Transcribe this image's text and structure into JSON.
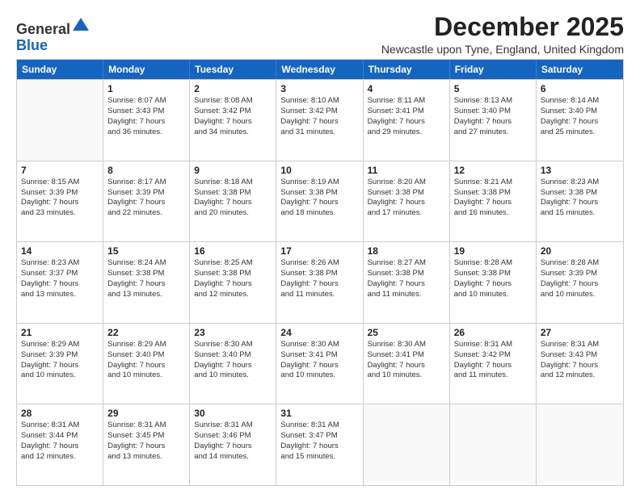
{
  "logo": {
    "general": "General",
    "blue": "Blue"
  },
  "header": {
    "title": "December 2025",
    "location": "Newcastle upon Tyne, England, United Kingdom"
  },
  "days": [
    "Sunday",
    "Monday",
    "Tuesday",
    "Wednesday",
    "Thursday",
    "Friday",
    "Saturday"
  ],
  "weeks": [
    [
      {
        "num": "",
        "lines": []
      },
      {
        "num": "1",
        "lines": [
          "Sunrise: 8:07 AM",
          "Sunset: 3:43 PM",
          "Daylight: 7 hours",
          "and 36 minutes."
        ]
      },
      {
        "num": "2",
        "lines": [
          "Sunrise: 8:08 AM",
          "Sunset: 3:42 PM",
          "Daylight: 7 hours",
          "and 34 minutes."
        ]
      },
      {
        "num": "3",
        "lines": [
          "Sunrise: 8:10 AM",
          "Sunset: 3:42 PM",
          "Daylight: 7 hours",
          "and 31 minutes."
        ]
      },
      {
        "num": "4",
        "lines": [
          "Sunrise: 8:11 AM",
          "Sunset: 3:41 PM",
          "Daylight: 7 hours",
          "and 29 minutes."
        ]
      },
      {
        "num": "5",
        "lines": [
          "Sunrise: 8:13 AM",
          "Sunset: 3:40 PM",
          "Daylight: 7 hours",
          "and 27 minutes."
        ]
      },
      {
        "num": "6",
        "lines": [
          "Sunrise: 8:14 AM",
          "Sunset: 3:40 PM",
          "Daylight: 7 hours",
          "and 25 minutes."
        ]
      }
    ],
    [
      {
        "num": "7",
        "lines": [
          "Sunrise: 8:15 AM",
          "Sunset: 3:39 PM",
          "Daylight: 7 hours",
          "and 23 minutes."
        ]
      },
      {
        "num": "8",
        "lines": [
          "Sunrise: 8:17 AM",
          "Sunset: 3:39 PM",
          "Daylight: 7 hours",
          "and 22 minutes."
        ]
      },
      {
        "num": "9",
        "lines": [
          "Sunrise: 8:18 AM",
          "Sunset: 3:38 PM",
          "Daylight: 7 hours",
          "and 20 minutes."
        ]
      },
      {
        "num": "10",
        "lines": [
          "Sunrise: 8:19 AM",
          "Sunset: 3:38 PM",
          "Daylight: 7 hours",
          "and 18 minutes."
        ]
      },
      {
        "num": "11",
        "lines": [
          "Sunrise: 8:20 AM",
          "Sunset: 3:38 PM",
          "Daylight: 7 hours",
          "and 17 minutes."
        ]
      },
      {
        "num": "12",
        "lines": [
          "Sunrise: 8:21 AM",
          "Sunset: 3:38 PM",
          "Daylight: 7 hours",
          "and 16 minutes."
        ]
      },
      {
        "num": "13",
        "lines": [
          "Sunrise: 8:23 AM",
          "Sunset: 3:38 PM",
          "Daylight: 7 hours",
          "and 15 minutes."
        ]
      }
    ],
    [
      {
        "num": "14",
        "lines": [
          "Sunrise: 8:23 AM",
          "Sunset: 3:37 PM",
          "Daylight: 7 hours",
          "and 13 minutes."
        ]
      },
      {
        "num": "15",
        "lines": [
          "Sunrise: 8:24 AM",
          "Sunset: 3:38 PM",
          "Daylight: 7 hours",
          "and 13 minutes."
        ]
      },
      {
        "num": "16",
        "lines": [
          "Sunrise: 8:25 AM",
          "Sunset: 3:38 PM",
          "Daylight: 7 hours",
          "and 12 minutes."
        ]
      },
      {
        "num": "17",
        "lines": [
          "Sunrise: 8:26 AM",
          "Sunset: 3:38 PM",
          "Daylight: 7 hours",
          "and 11 minutes."
        ]
      },
      {
        "num": "18",
        "lines": [
          "Sunrise: 8:27 AM",
          "Sunset: 3:38 PM",
          "Daylight: 7 hours",
          "and 11 minutes."
        ]
      },
      {
        "num": "19",
        "lines": [
          "Sunrise: 8:28 AM",
          "Sunset: 3:38 PM",
          "Daylight: 7 hours",
          "and 10 minutes."
        ]
      },
      {
        "num": "20",
        "lines": [
          "Sunrise: 8:28 AM",
          "Sunset: 3:39 PM",
          "Daylight: 7 hours",
          "and 10 minutes."
        ]
      }
    ],
    [
      {
        "num": "21",
        "lines": [
          "Sunrise: 8:29 AM",
          "Sunset: 3:39 PM",
          "Daylight: 7 hours",
          "and 10 minutes."
        ]
      },
      {
        "num": "22",
        "lines": [
          "Sunrise: 8:29 AM",
          "Sunset: 3:40 PM",
          "Daylight: 7 hours",
          "and 10 minutes."
        ]
      },
      {
        "num": "23",
        "lines": [
          "Sunrise: 8:30 AM",
          "Sunset: 3:40 PM",
          "Daylight: 7 hours",
          "and 10 minutes."
        ]
      },
      {
        "num": "24",
        "lines": [
          "Sunrise: 8:30 AM",
          "Sunset: 3:41 PM",
          "Daylight: 7 hours",
          "and 10 minutes."
        ]
      },
      {
        "num": "25",
        "lines": [
          "Sunrise: 8:30 AM",
          "Sunset: 3:41 PM",
          "Daylight: 7 hours",
          "and 10 minutes."
        ]
      },
      {
        "num": "26",
        "lines": [
          "Sunrise: 8:31 AM",
          "Sunset: 3:42 PM",
          "Daylight: 7 hours",
          "and 11 minutes."
        ]
      },
      {
        "num": "27",
        "lines": [
          "Sunrise: 8:31 AM",
          "Sunset: 3:43 PM",
          "Daylight: 7 hours",
          "and 12 minutes."
        ]
      }
    ],
    [
      {
        "num": "28",
        "lines": [
          "Sunrise: 8:31 AM",
          "Sunset: 3:44 PM",
          "Daylight: 7 hours",
          "and 12 minutes."
        ]
      },
      {
        "num": "29",
        "lines": [
          "Sunrise: 8:31 AM",
          "Sunset: 3:45 PM",
          "Daylight: 7 hours",
          "and 13 minutes."
        ]
      },
      {
        "num": "30",
        "lines": [
          "Sunrise: 8:31 AM",
          "Sunset: 3:46 PM",
          "Daylight: 7 hours",
          "and 14 minutes."
        ]
      },
      {
        "num": "31",
        "lines": [
          "Sunrise: 8:31 AM",
          "Sunset: 3:47 PM",
          "Daylight: 7 hours",
          "and 15 minutes."
        ]
      },
      {
        "num": "",
        "lines": []
      },
      {
        "num": "",
        "lines": []
      },
      {
        "num": "",
        "lines": []
      }
    ]
  ]
}
